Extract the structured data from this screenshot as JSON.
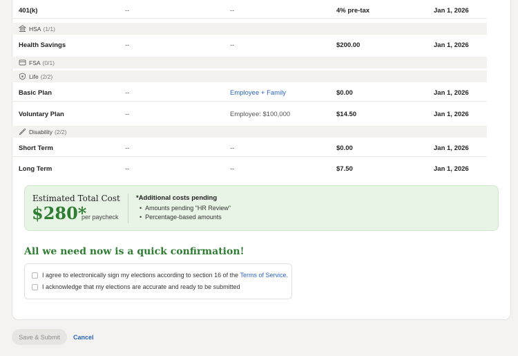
{
  "plan_rows": [
    {
      "name": "401(k)",
      "col2": "--",
      "col3": "--",
      "cost": "4% pre-tax",
      "effective": "Jan 1, 2026"
    },
    {
      "name": "Health Savings",
      "col2": "--",
      "col3": "--",
      "cost": "$200.00",
      "effective": "Jan 1, 2026"
    },
    {
      "name": "Basic Plan",
      "col2": "--",
      "col3": "Employee + Family",
      "cost": "$0.00",
      "effective": "Jan 1, 2026"
    },
    {
      "name": "Voluntary Plan",
      "col2": "--",
      "col3": "Employee: $100,000",
      "cost": "$14.50",
      "effective": "Jan 1, 2026"
    },
    {
      "name": "Short Term",
      "col2": "--",
      "col3": "--",
      "cost": "$0.00",
      "effective": "Jan 1, 2026"
    },
    {
      "name": "Long Term",
      "col2": "--",
      "col3": "--",
      "cost": "$7.50",
      "effective": "Jan 1, 2026"
    }
  ],
  "groups": [
    {
      "label": "HSA",
      "count": "(1/1)",
      "icon": "bank-icon"
    },
    {
      "label": "FSA",
      "count": "(0/1)",
      "icon": "card-icon"
    },
    {
      "label": "Life",
      "count": "(2/2)",
      "icon": "shield-icon"
    },
    {
      "label": "Disability",
      "count": "(2/2)",
      "icon": "bandage-icon"
    }
  ],
  "summary": {
    "title": "Estimated Total Cost",
    "amount": "$280",
    "asterisk": "*",
    "per": "per paycheck",
    "additional_title": "*Additional costs pending",
    "pending": [
      "Amounts pending \"HR Review\"",
      "Percentage-based amounts"
    ]
  },
  "confirmation": {
    "title": "All we need now is a quick confirmation!",
    "agree_text": "I agree to electronically sign my elections according to section 16 of the ",
    "terms_link": "Terms of Service",
    "agree_end": ".",
    "ack_text": "I acknowledge that my elections are accurate and ready to be submitted"
  },
  "footer": {
    "save_label": "Save & Submit",
    "cancel_label": "Cancel"
  },
  "colors": {
    "accent_green": "#2e7d32",
    "link_blue": "#2a63c9",
    "summary_bg": "#e8f4e6"
  }
}
